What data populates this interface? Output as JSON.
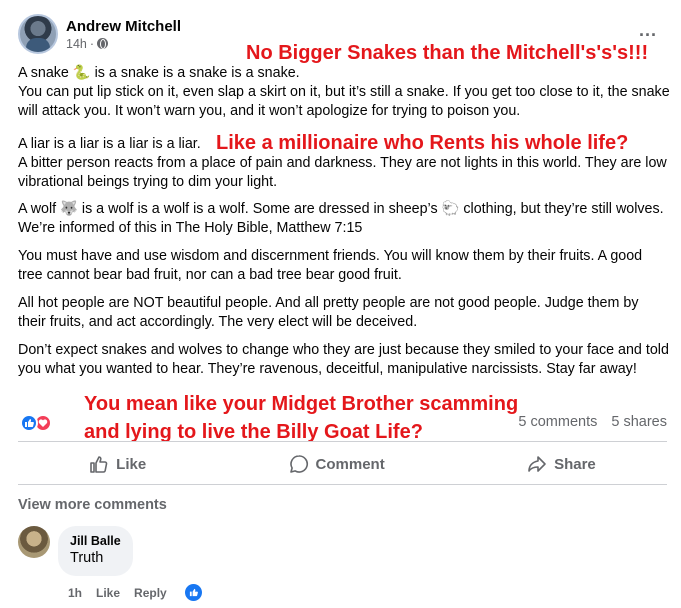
{
  "post": {
    "author": "Andrew Mitchell",
    "time": "14h",
    "separator": "·",
    "more": "...",
    "paragraphs": [
      "A snake 🐍 is a snake is a snake is a snake.\nYou can put lip stick on it, even slap a skirt on it, but it’s still a snake. If you get too close to it, the snake will attack you. It won’t warn you, and it won’t apologize for trying to poison you.",
      "A liar is a liar is a liar is a liar.",
      "A bitter person reacts from a place of pain and darkness. They are not lights in this world. They are low vibrational beings trying to dim your light.",
      "A wolf 🐺 is a wolf is a wolf is a wolf. Some are dressed in sheep’s 🐑 clothing, but they’re still wolves. We’re informed of this in The Holy Bible, Matthew 7:15",
      "You must have and use wisdom and discernment friends. You will know them by their fruits. A good tree cannot bear bad fruit, nor can a bad tree bear good fruit.",
      "All hot people are NOT beautiful people. And all pretty people are not good people. Judge them by their fruits, and act accordingly. The very elect will be deceived.",
      "Don’t expect snakes and wolves to change who they are just because they smiled to your face and told you what you wanted to hear. They’re ravenous, deceitful, manipulative narcissists. Stay far away!"
    ],
    "comments_count": "5 comments",
    "shares_count": "5 shares"
  },
  "overlays": {
    "top": "No Bigger Snakes than the Mitchell's's's!!!",
    "middle": "Like a millionaire who Rents his whole life?",
    "bottom": "You mean like your Midget Brother scamming and lying to live the Billy Goat Life?"
  },
  "actions": {
    "like": "Like",
    "comment": "Comment",
    "share": "Share"
  },
  "view_more": "View more comments",
  "comment": {
    "name": "Jill Balle",
    "text": "Truth",
    "time": "1h",
    "like": "Like",
    "reply": "Reply"
  },
  "colors": {
    "accent": "#1877f2",
    "love": "#f33e58",
    "overlay_text": "#e4171b"
  }
}
